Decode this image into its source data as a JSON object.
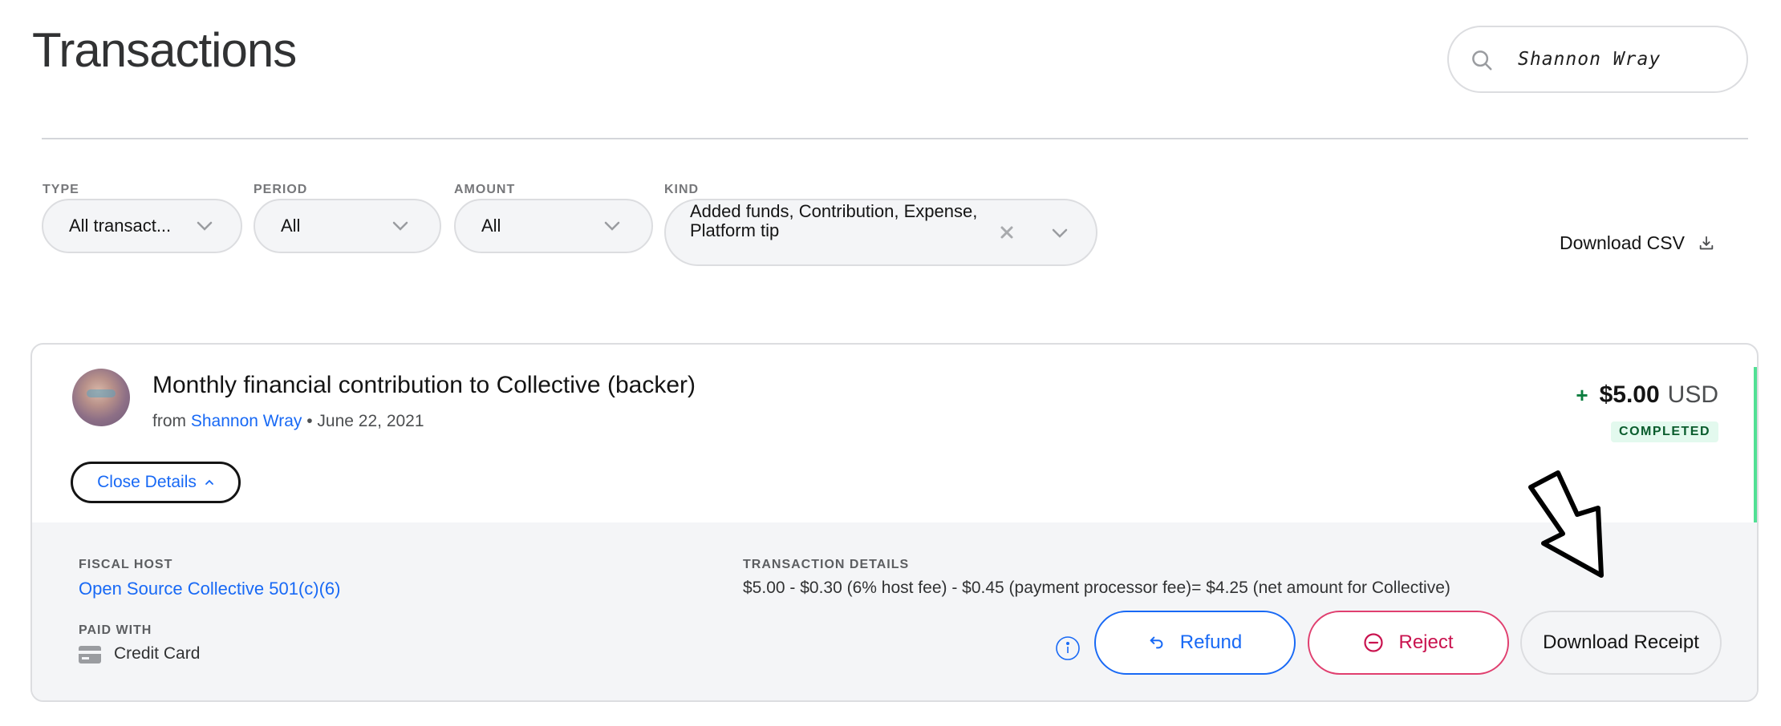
{
  "header": {
    "title": "Transactions",
    "search_value": "Shannon Wray"
  },
  "filters": {
    "type": {
      "label": "TYPE",
      "value": "All transact..."
    },
    "period": {
      "label": "PERIOD",
      "value": "All"
    },
    "amount": {
      "label": "AMOUNT",
      "value": "All"
    },
    "kind": {
      "label": "KIND",
      "value": "Added funds, Contribution, Expense, Platform tip"
    },
    "download_csv": "Download CSV"
  },
  "transaction": {
    "title": "Monthly financial contribution to Collective (backer)",
    "from_prefix": "from",
    "from_name": "Shannon Wray",
    "date_separator": "•",
    "date": "June 22, 2021",
    "amount_sign": "+",
    "amount": "$5.00",
    "currency": "USD",
    "status": "COMPLETED",
    "close_details": "Close Details",
    "fiscal_host_label": "FISCAL HOST",
    "fiscal_host": "Open Source Collective 501(c)(6)",
    "paid_with_label": "PAID WITH",
    "paid_with": "Credit Card",
    "details_label": "TRANSACTION DETAILS",
    "details_text": "$5.00 - $0.30 (6% host fee) - $0.45 (payment processor fee)= $4.25 (net amount for Collective)",
    "refund_label": "Refund",
    "reject_label": "Reject",
    "receipt_label": "Download Receipt"
  },
  "colors": {
    "link": "#1869f5",
    "reject": "#c9134f",
    "success_bg": "#e3f9ee",
    "success_text": "#0a5c2d",
    "accent_green": "#51e094"
  },
  "icons": [
    "search-icon",
    "chevron-down-icon",
    "close-icon",
    "download-icon",
    "chevron-up-icon",
    "credit-card-icon",
    "info-icon",
    "undo-icon",
    "minus-circle-icon",
    "arrow-annotation-icon"
  ]
}
